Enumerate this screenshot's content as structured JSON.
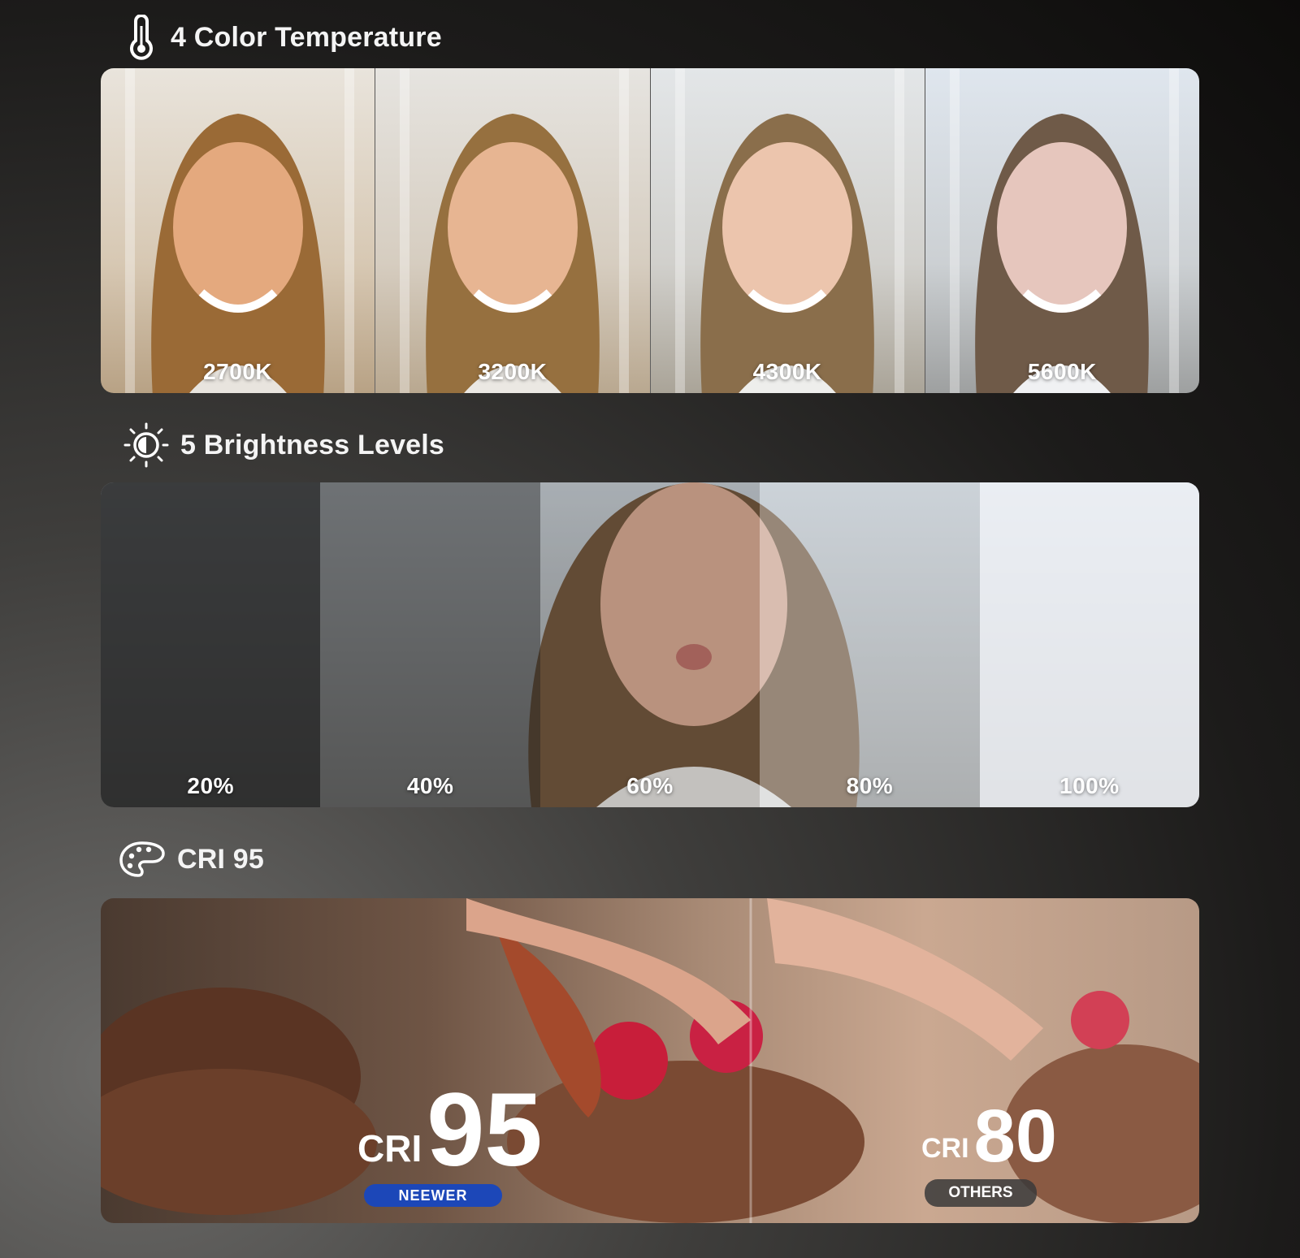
{
  "sections": {
    "color_temperature": {
      "title": "4 Color Temperature",
      "icon": "thermometer-icon",
      "levels": [
        "2700K",
        "3200K",
        "4300K",
        "5600K"
      ]
    },
    "brightness": {
      "title": "5 Brightness Levels",
      "icon": "brightness-icon",
      "levels": [
        "20%",
        "40%",
        "60%",
        "80%",
        "100%"
      ]
    },
    "cri": {
      "title": "CRI 95",
      "icon": "palette-icon",
      "neewer": {
        "prefix": "CRI",
        "value": "95",
        "badge": "NEEWER",
        "badge_color": "#1c47b8"
      },
      "others": {
        "prefix": "CRI",
        "value": "80",
        "badge": "OTHERS",
        "badge_color": "#3a3a3a"
      }
    }
  }
}
